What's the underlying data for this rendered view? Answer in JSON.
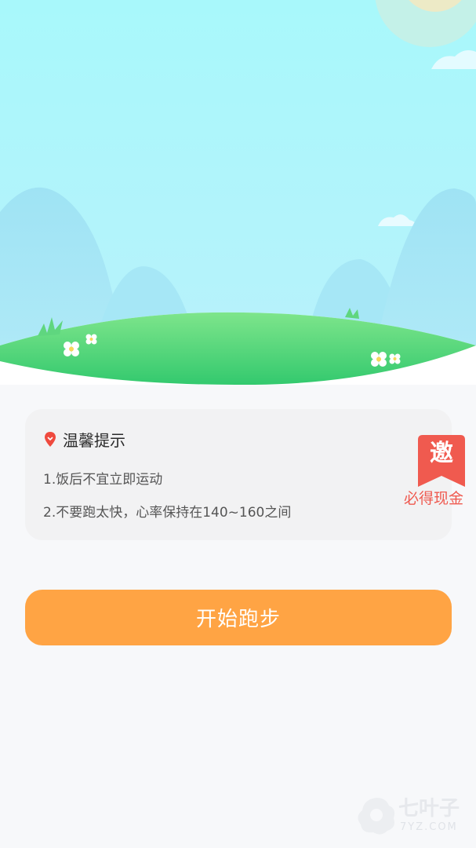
{
  "tips": {
    "title": "温馨提示",
    "items": [
      "1.饭后不宜立即运动",
      "2.不要跑太快，心率保持在140~160之间"
    ]
  },
  "invite": {
    "badge_char": "邀",
    "caption": "必得现金"
  },
  "start_button": {
    "label": "开始跑步"
  },
  "watermark": {
    "name": "七叶子",
    "domain": "7YZ.COM"
  },
  "colors": {
    "sky_top": "#a8f6fb",
    "grass": "#4cd47a",
    "button": "#ffa444",
    "invite": "#ef5a50",
    "card": "#f2f2f3"
  }
}
